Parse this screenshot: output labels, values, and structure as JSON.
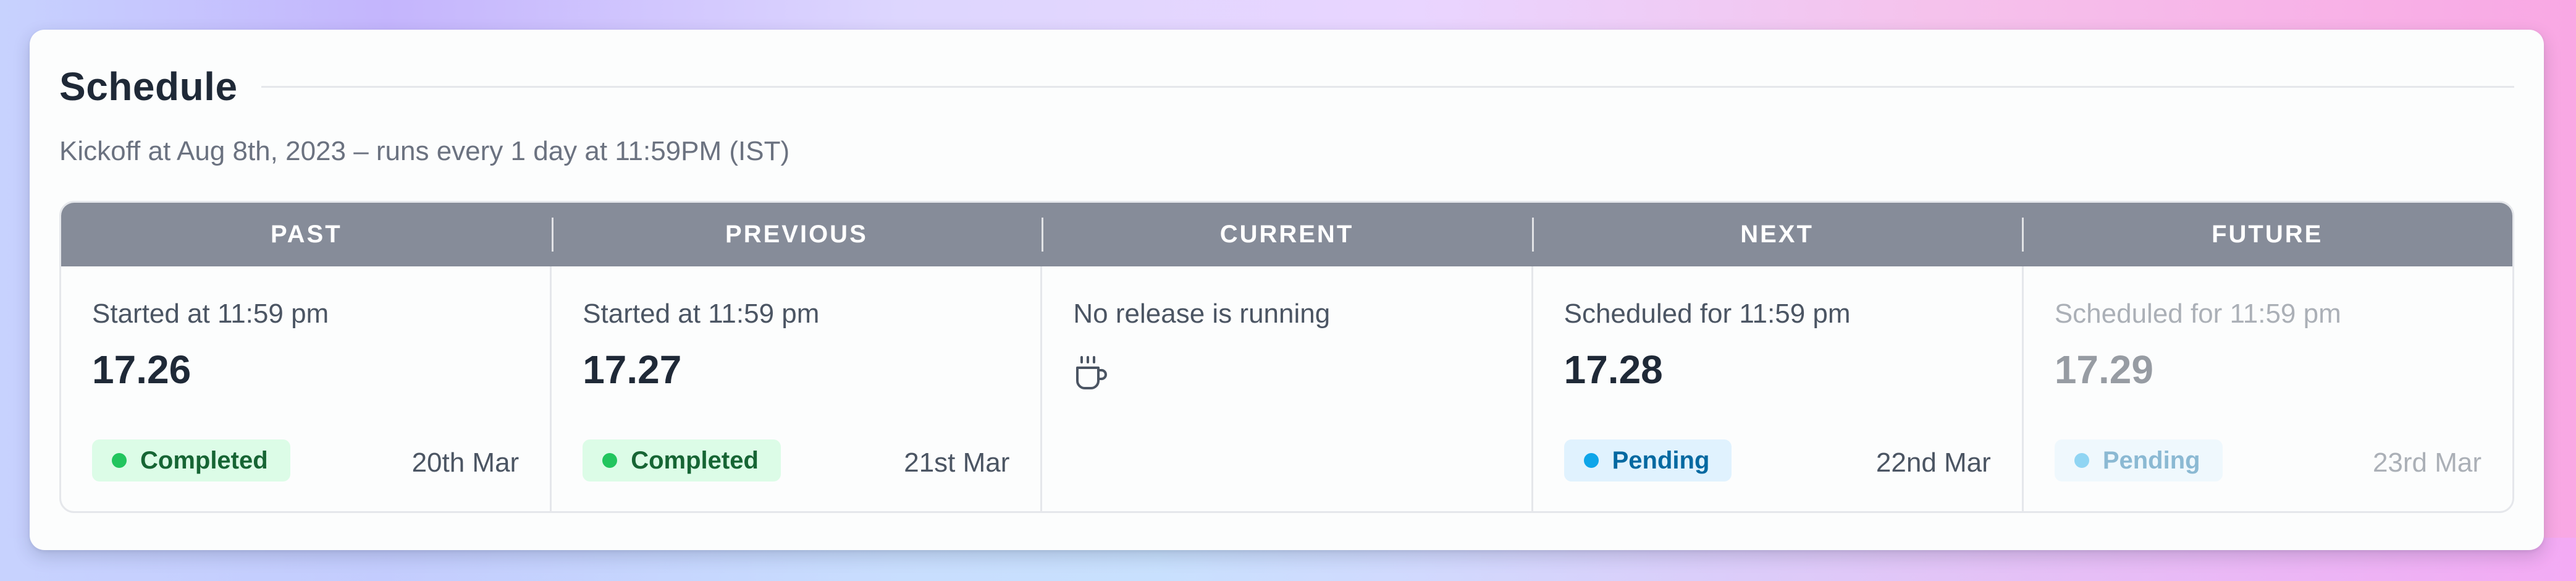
{
  "schedule": {
    "title": "Schedule",
    "subtitle": "Kickoff at Aug 8th, 2023 – runs every 1 day at 11:59PM (IST)"
  },
  "timeline": {
    "headers": [
      "PAST",
      "PREVIOUS",
      "CURRENT",
      "NEXT",
      "FUTURE"
    ],
    "past": {
      "label": "Started at 11:59 pm",
      "version": "17.26",
      "status": "Completed",
      "date": "20th Mar"
    },
    "previous": {
      "label": "Started at 11:59 pm",
      "version": "17.27",
      "status": "Completed",
      "date": "21st Mar"
    },
    "current": {
      "label": "No release is running",
      "icon": "coffee-icon"
    },
    "next": {
      "label": "Scheduled for 11:59 pm",
      "version": "17.28",
      "status": "Pending",
      "date": "22nd Mar"
    },
    "future": {
      "label": "Scheduled for 11:59 pm",
      "version": "17.29",
      "status": "Pending",
      "date": "23rd Mar"
    }
  },
  "colors": {
    "header_bg": "#868c99",
    "completed_bg": "#dcfce7",
    "completed_dot": "#22c55e",
    "pending_bg": "#e0f2fe",
    "pending_dot": "#0ea5e9"
  }
}
